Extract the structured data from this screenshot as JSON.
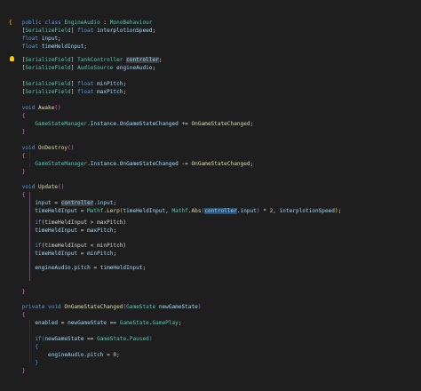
{
  "code": {
    "class_decl": {
      "mod": "public",
      "kw": "class",
      "name": "EngineAudio",
      "sep": " : ",
      "base": "MonoBehaviour"
    },
    "field1": {
      "attr_open": "[",
      "attr": "SerializeField",
      "attr_close": "]",
      "type": "float",
      "name": "interplotionSpeed",
      "end": ";"
    },
    "field2": {
      "type": "float",
      "name": "input",
      "end": ";"
    },
    "field3": {
      "type": "float",
      "name": "timeHeldInput",
      "end": ";"
    },
    "field4": {
      "attr_open": "[",
      "attr": "SerializeField",
      "attr_close": "]",
      "type": "TankController",
      "name": "controller",
      "end": ";"
    },
    "field5": {
      "attr_open": "[",
      "attr": "SerializeField",
      "attr_close": "]",
      "type": "AudioSource",
      "name": "engineAudio",
      "end": ";"
    },
    "field6": {
      "attr_open": "[",
      "attr": "SerializeField",
      "attr_close": "]",
      "type": "float",
      "name": "minPitch",
      "end": ";"
    },
    "field7": {
      "attr_open": "[",
      "attr": "SerializeField",
      "attr_close": "]",
      "type": "float",
      "name": "maxPitch",
      "end": ";"
    },
    "awake": {
      "kw": "void",
      "name": "Awake",
      "parens": "()"
    },
    "awake_body": {
      "cls": "GameStateManager",
      "dot1": ".",
      "inst": "Instance",
      "dot2": ".",
      "evt": "OnGameStateChanged",
      "op": " += ",
      "handler": "OnGameStateChanged",
      "end": ";"
    },
    "ondestroy": {
      "kw": "void",
      "name": "OnDestroy",
      "parens": "()"
    },
    "ondestroy_body": {
      "cls": "GameStateManager",
      "dot1": ".",
      "inst": "Instance",
      "dot2": ".",
      "evt": "OnGameStateChanged",
      "op": " -= ",
      "handler": "OnGameStateChanged",
      "end": ";"
    },
    "update": {
      "kw": "void",
      "name": "Update",
      "parens": "()"
    },
    "u1": {
      "lhs": "input",
      "op": " = ",
      "obj": "controller",
      "dot": ".",
      "prop": "input",
      "end": ";"
    },
    "u2": {
      "lhs": "timeHeldInput",
      "op": " = ",
      "cls": "Mathf",
      "dot": ".",
      "fn": "Lerp",
      "open": "(",
      "a1": "timeHeldInput",
      "comma1": ", ",
      "cls2": "Mathf",
      "dot2": ".",
      "fn2": "Abs",
      "open2": "(",
      "obj": "controller",
      "dot3": ".",
      "prop": "input",
      "close2": ")",
      "mul": " * ",
      "num": "2",
      "comma2": ", ",
      "a3": "interplotionSpeed",
      "close": ")",
      "end": ";"
    },
    "u3": {
      "kw": "if",
      "cond": "(timeHeldInput > maxPitch)"
    },
    "u4": {
      "lhs": "timeHeldInput",
      "op": " = ",
      "rhs": "maxPitch",
      "end": ";"
    },
    "u5": {
      "kw": "if",
      "cond": "(timeHeldInput < minPitch)"
    },
    "u6": {
      "lhs": "timeHeldInput",
      "op": " = ",
      "rhs": "minPitch",
      "end": ";"
    },
    "u7": {
      "obj": "engineAudio",
      "dot": ".",
      "prop": "pitch",
      "op": " = ",
      "rhs": "timeHeldInput",
      "end": ";"
    },
    "handler": {
      "mod": "private",
      "kw": "void",
      "name": "OnGameStateChanged",
      "open": "(",
      "ptype": "GameState",
      "pname": "newGameState",
      "close": ")"
    },
    "h1": {
      "lhs": "enabled",
      "op": " = ",
      "a": "newGameState",
      "eq": " == ",
      "cls": "GameState",
      "dot": ".",
      "val": "GamePlay",
      "end": ";"
    },
    "h2": {
      "kw": "if",
      "open": "(",
      "a": "newGameState",
      "eq": " == ",
      "cls": "GameState",
      "dot": ".",
      "val": "Paused",
      "close": ")"
    },
    "h3": {
      "obj": "engineAudio",
      "dot": ".",
      "prop": "pitch",
      "op": " = ",
      "num": "0",
      "end": ";"
    }
  }
}
